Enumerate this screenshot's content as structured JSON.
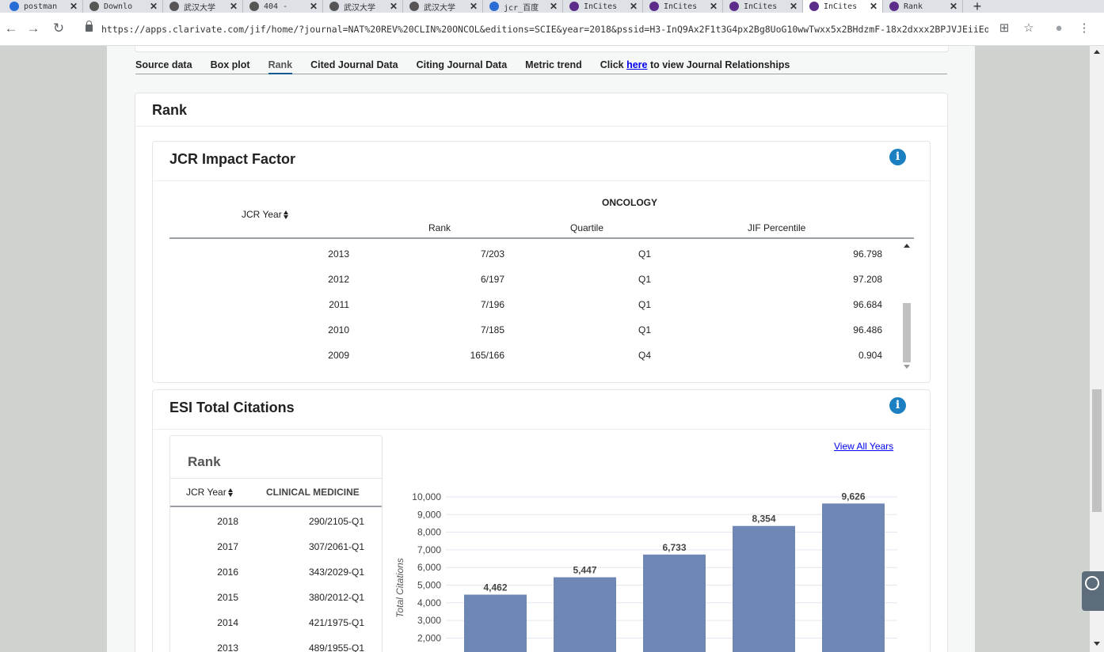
{
  "browser": {
    "tabs": [
      {
        "label": "postman",
        "color": "#2a6cd6"
      },
      {
        "label": "Downlo",
        "color": "#555555"
      },
      {
        "label": "武汉大学",
        "color": "#555555"
      },
      {
        "label": "404 - ",
        "color": "#555555"
      },
      {
        "label": "武汉大学",
        "color": "#555555"
      },
      {
        "label": "武汉大学",
        "color": "#555555"
      },
      {
        "label": "jcr_百度",
        "color": "#2a6cd6"
      },
      {
        "label": "InCites",
        "color": "#5b2c8a"
      },
      {
        "label": "InCites",
        "color": "#5b2c8a"
      },
      {
        "label": "InCites",
        "color": "#5b2c8a"
      },
      {
        "label": "InCites",
        "color": "#5b2c8a"
      },
      {
        "label": "Rank",
        "color": "#5b2c8a"
      }
    ],
    "active_tab_index": 10,
    "close_glyph": "✕",
    "new_tab_glyph": "+",
    "url": "https://apps.clarivate.com/jif/home/?journal=NAT%20REV%20CLIN%20ONCOL&editions=SCIE&year=2018&pssid=H3-InQ9Ax2F1t3G4px2Bg8UoG10wwTwxx5x2BHdzmF-18x2dxxx2BPJVJEiiEo…",
    "icons": [
      "back-icon",
      "forward-icon",
      "reload-icon",
      "lock-icon",
      "translate-icon",
      "star-icon",
      "profile-icon",
      "menu-icon"
    ]
  },
  "subnav": {
    "items": [
      "Source data",
      "Box plot",
      "Rank",
      "Cited Journal Data",
      "Citing Journal Data",
      "Metric trend"
    ],
    "active": "Rank",
    "click_prefix": "Click ",
    "link_text": "here",
    "click_suffix": " to view Journal Relationships"
  },
  "rank_card": {
    "title": "Rank"
  },
  "jcr": {
    "title": "JCR Impact Factor",
    "info_glyph": "i",
    "year_header": "JCR Year",
    "category": "ONCOLOGY",
    "col_rank": "Rank",
    "col_quartile": "Quartile",
    "col_percentile": "JIF Percentile",
    "rows": [
      {
        "year": "2013",
        "rank": "7/203",
        "quartile": "Q1",
        "percentile": "96.798"
      },
      {
        "year": "2012",
        "rank": "6/197",
        "quartile": "Q1",
        "percentile": "97.208"
      },
      {
        "year": "2011",
        "rank": "7/196",
        "quartile": "Q1",
        "percentile": "96.684"
      },
      {
        "year": "2010",
        "rank": "7/185",
        "quartile": "Q1",
        "percentile": "96.486"
      },
      {
        "year": "2009",
        "rank": "165/166",
        "quartile": "Q4",
        "percentile": "0.904"
      }
    ]
  },
  "esi": {
    "title": "ESI Total Citations",
    "info_glyph": "i",
    "rank_title": "Rank",
    "year_header": "JCR Year",
    "category": "CLINICAL MEDICINE",
    "rows": [
      {
        "year": "2018",
        "value": "290/2105-Q1"
      },
      {
        "year": "2017",
        "value": "307/2061-Q1"
      },
      {
        "year": "2016",
        "value": "343/2029-Q1"
      },
      {
        "year": "2015",
        "value": "380/2012-Q1"
      },
      {
        "year": "2014",
        "value": "421/1975-Q1"
      },
      {
        "year": "2013",
        "value": "489/1955-Q1"
      }
    ],
    "view_all": "View All Years"
  },
  "chart_data": {
    "type": "bar",
    "title": "",
    "xlabel": "",
    "ylabel": "Total Citations",
    "values": [
      4462,
      5447,
      6733,
      8354,
      9626
    ],
    "value_labels": [
      "4,462",
      "5,447",
      "6,733",
      "8,354",
      "9,626"
    ],
    "yticks": [
      "10,000",
      "9,000",
      "8,000",
      "7,000",
      "6,000",
      "5,000",
      "4,000",
      "3,000",
      "2,000"
    ],
    "ylim_visible": [
      2000,
      10000
    ],
    "bar_color": "#6f87b5",
    "grid": true
  }
}
